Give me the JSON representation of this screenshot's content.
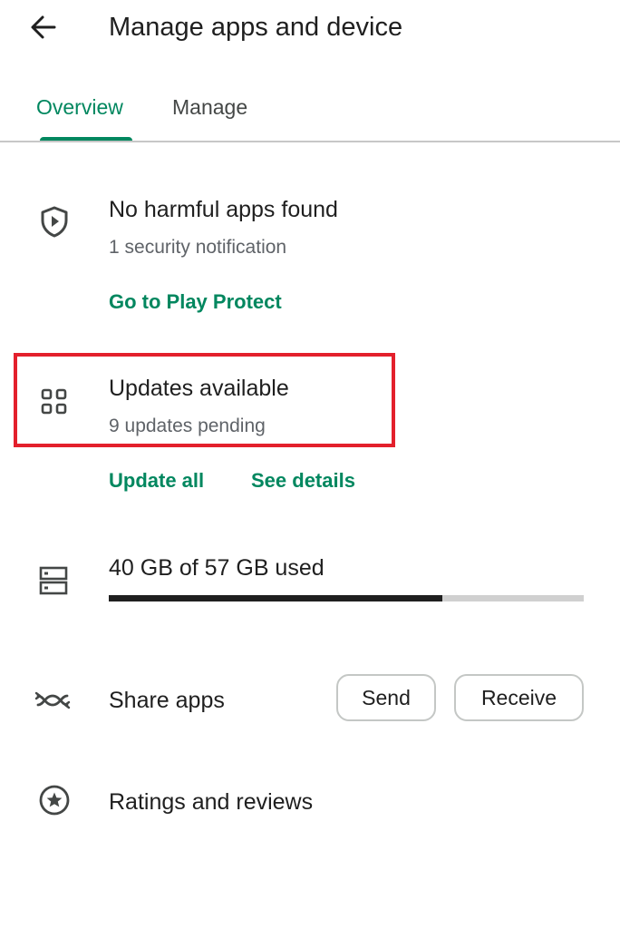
{
  "header": {
    "title": "Manage apps and device",
    "back_icon": "arrow-back-icon"
  },
  "tabs": [
    {
      "label": "Overview",
      "selected": true
    },
    {
      "label": "Manage",
      "selected": false
    }
  ],
  "colors": {
    "accent": "#01875f",
    "highlight_border": "#e3202c",
    "text_primary": "#1f1f1f",
    "text_secondary": "#5f6368",
    "divider": "#c7c7c7",
    "storage_track": "#d0d0d0"
  },
  "play_protect": {
    "icon": "shield-play-icon",
    "title": "No harmful apps found",
    "subtitle": "1 security notification",
    "link": "Go to Play Protect"
  },
  "updates": {
    "icon": "apps-grid-icon",
    "title": "Updates available",
    "subtitle": "9 updates pending",
    "update_all_label": "Update all",
    "see_details_label": "See details",
    "highlighted": true
  },
  "storage": {
    "icon": "storage-icon",
    "title": "40 GB of 57 GB used",
    "used_gb": 40,
    "total_gb": 57
  },
  "share": {
    "icon": "share-apps-icon",
    "title": "Share apps",
    "send_label": "Send",
    "receive_label": "Receive"
  },
  "ratings": {
    "icon": "star-circle-icon",
    "title": "Ratings and reviews"
  }
}
